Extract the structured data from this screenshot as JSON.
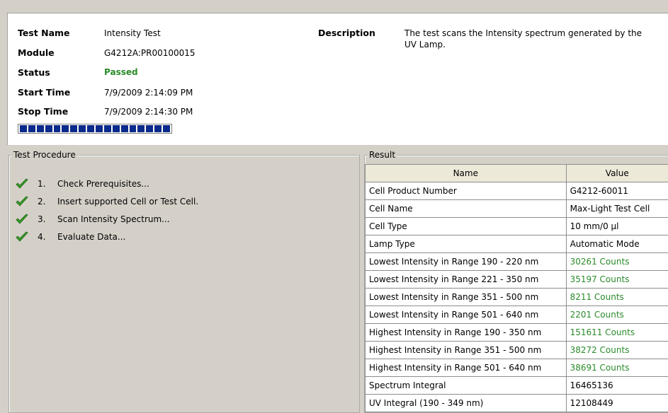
{
  "header": {
    "test_name_label": "Test Name",
    "test_name": "Intensity Test",
    "module_label": "Module",
    "module": "G4212A:PR00100015",
    "status_label": "Status",
    "status": "Passed",
    "start_label": "Start Time",
    "start_time": "7/9/2009 2:14:09 PM",
    "stop_label": "Stop Time",
    "stop_time": "7/9/2009 2:14:30 PM",
    "description_label": "Description",
    "description": "The test scans the Intensity spectrum generated by the UV Lamp.",
    "progress_fraction": 1.0
  },
  "procedure": {
    "title": "Test Procedure",
    "steps": [
      {
        "num": "1.",
        "text": "Check Prerequisites..."
      },
      {
        "num": "2.",
        "text": "Insert supported Cell or Test Cell."
      },
      {
        "num": "3.",
        "text": "Scan Intensity Spectrum..."
      },
      {
        "num": "4.",
        "text": "Evaluate Data..."
      }
    ]
  },
  "result": {
    "title": "Result",
    "columns": [
      "Name",
      "Value"
    ],
    "rows": [
      {
        "name": "Cell Product Number",
        "value": "G4212-60011",
        "ok": false
      },
      {
        "name": "Cell Name",
        "value": "Max-Light Test Cell",
        "ok": false
      },
      {
        "name": "Cell Type",
        "value": "10 mm/0 µl",
        "ok": false
      },
      {
        "name": "Lamp Type",
        "value": "Automatic Mode",
        "ok": false
      },
      {
        "name": "Lowest Intensity in Range 190 - 220 nm",
        "value": "30261 Counts",
        "ok": true
      },
      {
        "name": "Lowest Intensity in Range 221 - 350 nm",
        "value": "35197 Counts",
        "ok": true
      },
      {
        "name": "Lowest Intensity in Range 351 - 500 nm",
        "value": "8211 Counts",
        "ok": true
      },
      {
        "name": "Lowest Intensity in Range 501 - 640 nm",
        "value": "2201 Counts",
        "ok": true
      },
      {
        "name": "Highest Intensity in Range 190 - 350 nm",
        "value": "151611 Counts",
        "ok": true
      },
      {
        "name": "Highest Intensity in Range 351 - 500 nm",
        "value": "38272 Counts",
        "ok": true
      },
      {
        "name": "Highest Intensity in Range 501 - 640 nm",
        "value": "38691 Counts",
        "ok": true
      },
      {
        "name": "Spectrum Integral",
        "value": "16465136",
        "ok": false
      },
      {
        "name": "UV Integral (190 - 349 nm)",
        "value": "12108449",
        "ok": false
      }
    ]
  },
  "colors": {
    "passed": "#2a8a2a",
    "progress": "#0a2a8c",
    "check": "#3a9a2a"
  },
  "icons": {
    "step_status": "checkmark-icon"
  }
}
